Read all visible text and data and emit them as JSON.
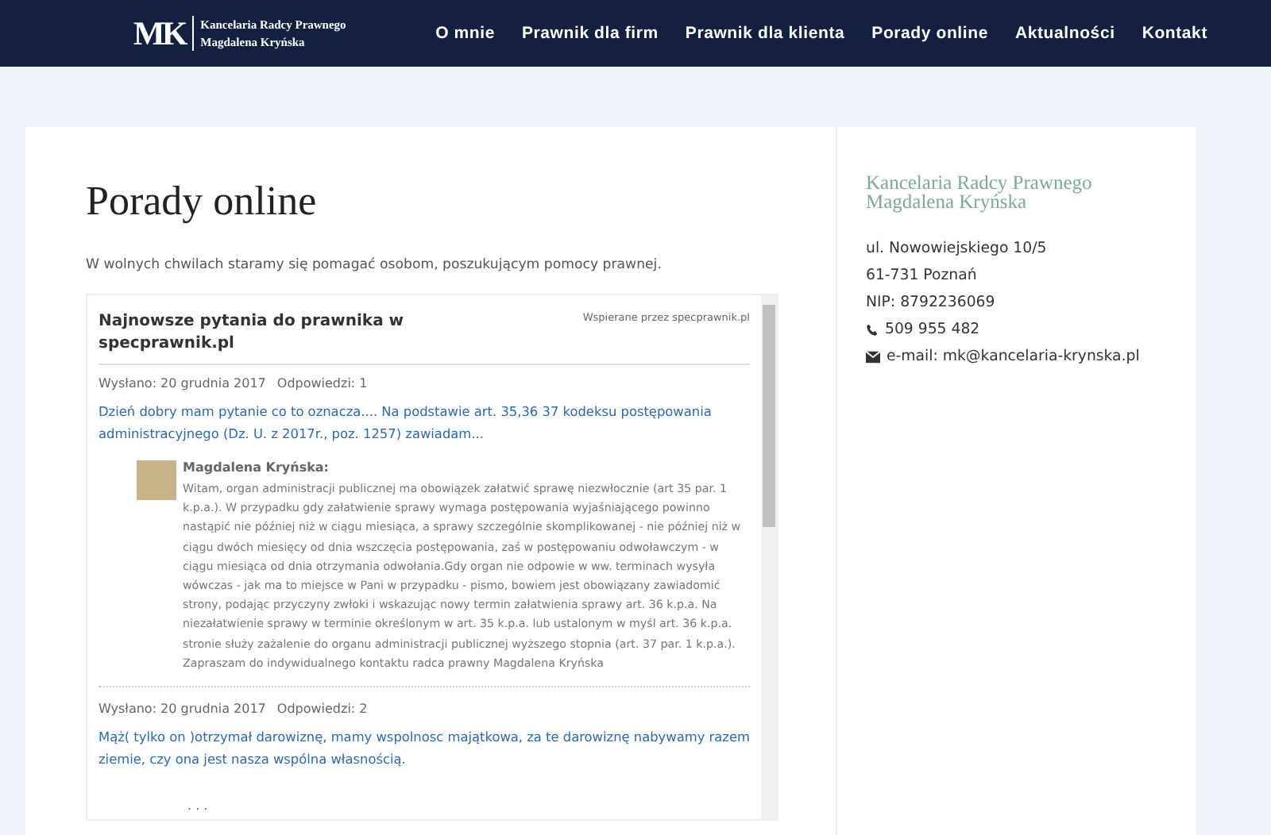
{
  "header": {
    "logo_mark": "MK",
    "logo_lines": [
      "Kancelaria Radcy Prawnego",
      "Magdalena Kryńska"
    ],
    "nav": [
      {
        "label": "O mnie"
      },
      {
        "label": "Prawnik dla firm"
      },
      {
        "label": "Prawnik dla klienta"
      },
      {
        "label": "Porady online"
      },
      {
        "label": "Aktualności"
      },
      {
        "label": "Kontakt"
      }
    ]
  },
  "main": {
    "title": "Porady online",
    "intro": "W wolnych chwilach staramy się pomagać osobom, poszukującym pomocy prawnej.",
    "widget": {
      "title": "Najnowsze pytania do prawnika w specprawnik.pl",
      "powered_by": "Wspierane przez specprawnik.pl",
      "questions": [
        {
          "sent": "Wysłano: 20 grudnia 2017",
          "answers": "Odpowiedzi: 1",
          "question": "Dzień dobry mam pytanie co to oznacza.... Na podstawie art. 35,36 37 kodeksu postępowania administracyjnego (Dz. U. z 2017r., poz. 1257) zawiadam...",
          "reply": {
            "author": "Magdalena Kryńska:",
            "text": "Witam, organ administracji publicznej ma obowiązek załatwić sprawę niezwłocznie (art 35 par. 1 k.p.a.). W przypadku gdy załatwienie sprawy wymaga postępowania wyjaśniającego powinno nastąpić nie później niż w ciągu miesiąca, a sprawy szczególnie skomplikowanej - nie później niż w ciągu dwóch miesięcy od dnia wszczęcia postępowania, zaś w postępowaniu odwoławczym - w ciągu miesiąca od dnia otrzymania odwołania.Gdy organ nie odpowie w ww. terminach wysyła wówczas - jak ma to miejsce w Pani w przypadku - pismo, bowiem jest obowiązany zawiadomić strony, podając przyczyny zwłoki i wskazując nowy termin załatwienia sprawy art. 36 k.p.a. Na niezałatwienie sprawy w terminie określonym w art. 35 k.p.a. lub ustalonym w myśl art. 36 k.p.a. stronie służy zażalenie do organu administracji publicznej wyższego stopnia (art. 37 par. 1 k.p.a.). Zapraszam do indywidualnego kontaktu radca prawny Magdalena Kryńska"
          }
        },
        {
          "sent": "Wysłano: 20 grudnia 2017",
          "answers": "Odpowiedzi: 2",
          "question": "Mąż( tylko on )otrzymał darowiznę, mamy wspolnosc majątkowa, za te darowiznę nabywamy razem ziemie, czy ona jest nasza wspólna własnością."
        }
      ],
      "more": ". . ."
    }
  },
  "sidebar": {
    "title_lines": [
      "Kancelaria Radcy Prawnego",
      "Magdalena Kryńska"
    ],
    "contacts": [
      {
        "kind": "text",
        "text": "ul. Nowowiejskiego 10/5"
      },
      {
        "kind": "text",
        "text": "61-731 Poznań"
      },
      {
        "kind": "text",
        "text": "NIP: 8792236069"
      },
      {
        "kind": "phone",
        "text": "509 955 482"
      },
      {
        "kind": "email",
        "text": "e-mail: mk@kancelaria-krynska.pl"
      }
    ]
  }
}
